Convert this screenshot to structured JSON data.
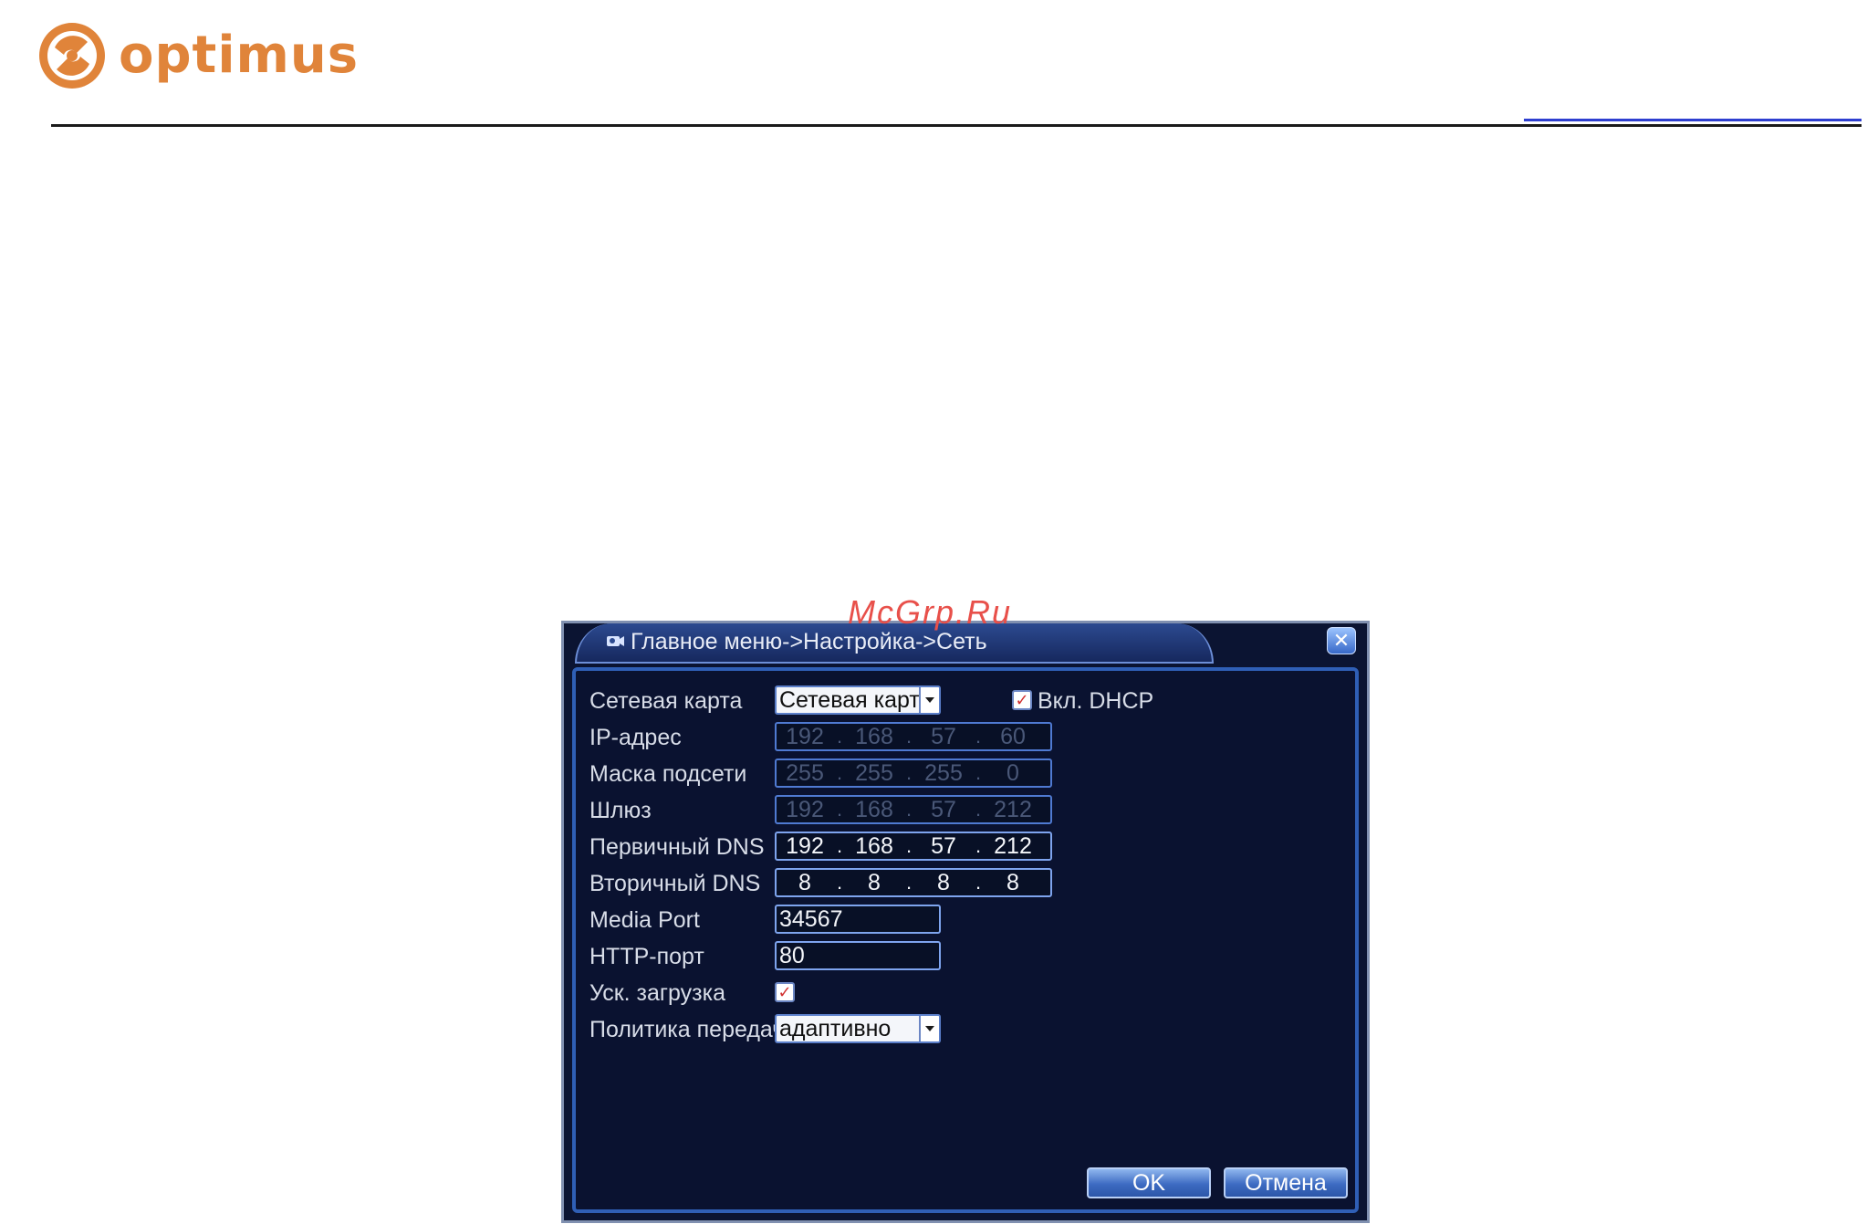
{
  "header": {
    "brand": "optimus",
    "colors": {
      "brand": "#e0843a",
      "rule": "#1a1a1a",
      "link": "#2e3fd0"
    }
  },
  "watermark": "McGrp.Ru",
  "dialog": {
    "icon": "camera-icon",
    "breadcrumb": "Главное меню->Настройка->Сеть",
    "close_icon": "close-icon",
    "colors": {
      "background": "#0b1432",
      "border": "#2f5fb6",
      "text": "#d8dde8"
    },
    "fields": {
      "network_card": {
        "label": "Сетевая карта",
        "value": "Сетевая карта"
      },
      "dhcp": {
        "label": "Вкл. DHCP",
        "checked": true
      },
      "ip": {
        "label": "IP-адрес",
        "octets": [
          "192",
          "168",
          "57",
          "60"
        ]
      },
      "mask": {
        "label": "Маска подсети",
        "octets": [
          "255",
          "255",
          "255",
          "0"
        ]
      },
      "gateway": {
        "label": "Шлюз",
        "octets": [
          "192",
          "168",
          "57",
          "212"
        ]
      },
      "dns1": {
        "label": "Первичный DNS",
        "octets": [
          "192",
          "168",
          "57",
          "212"
        ]
      },
      "dns2": {
        "label": "Вторичный DNS",
        "octets": [
          "8",
          "8",
          "8",
          "8"
        ]
      },
      "media_port": {
        "label": "Media Port",
        "value": "34567"
      },
      "http_port": {
        "label": "HTTP-порт",
        "value": "80"
      },
      "fast_download": {
        "label": "Уск. загрузка",
        "checked": true
      },
      "transfer_policy": {
        "label": "Политика передачи",
        "value": "адаптивно"
      }
    },
    "buttons": {
      "ok": "OK",
      "cancel": "Отмена"
    }
  }
}
